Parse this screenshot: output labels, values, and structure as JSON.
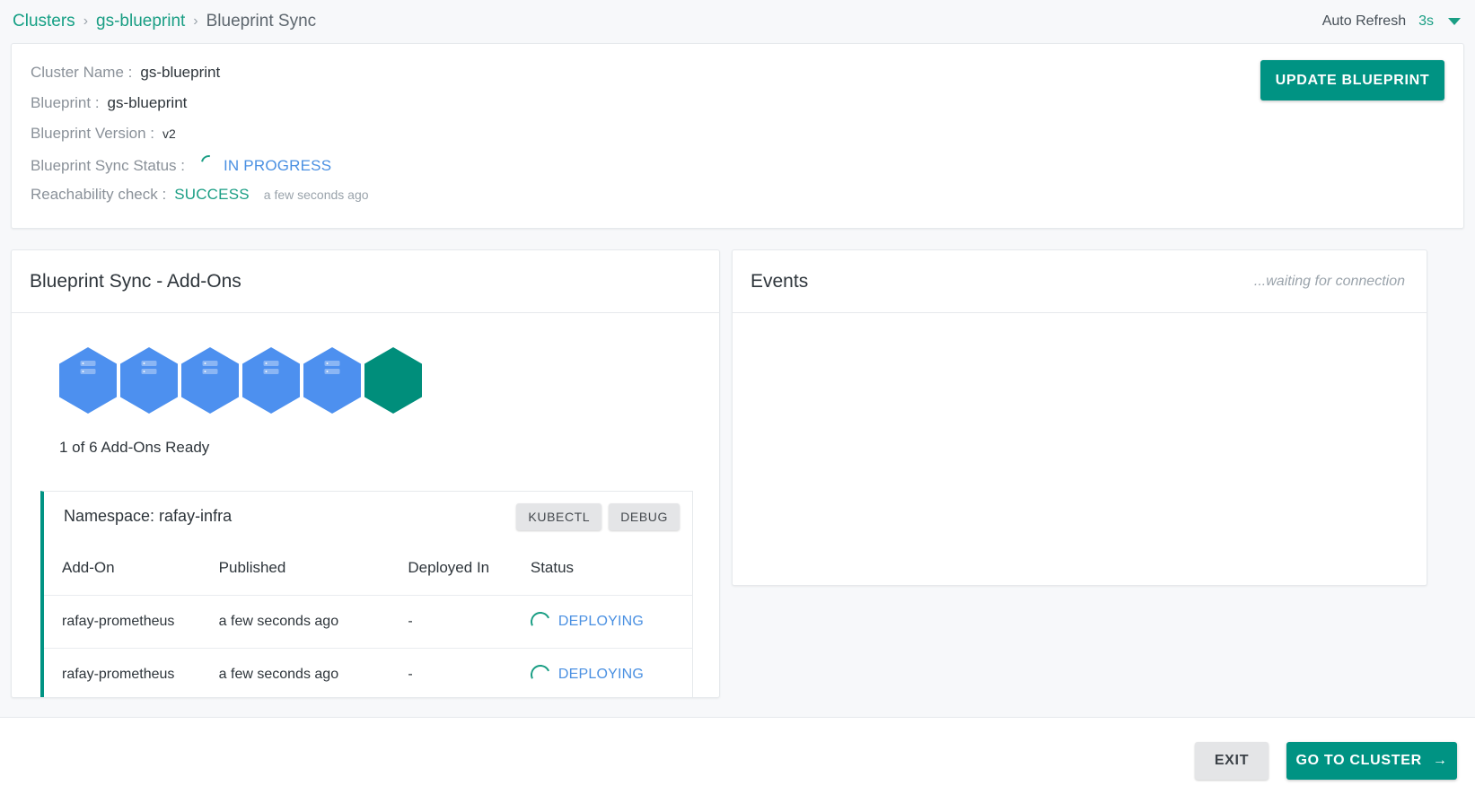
{
  "breadcrumb": {
    "items": [
      {
        "label": "Clusters",
        "type": "link"
      },
      {
        "label": "gs-blueprint",
        "type": "link"
      },
      {
        "label": "Blueprint Sync",
        "type": "current"
      }
    ],
    "separator": "›"
  },
  "auto_refresh": {
    "label": "Auto Refresh",
    "value": "3s",
    "chevron_icon": "chevron-down-icon"
  },
  "info": {
    "cluster_name_label": "Cluster Name :",
    "cluster_name_value": "gs-blueprint",
    "blueprint_label": "Blueprint :",
    "blueprint_value": "gs-blueprint",
    "blueprint_version_label": "Blueprint Version :",
    "blueprint_version_value": "v2",
    "sync_status_label": "Blueprint Sync Status :",
    "sync_status_value": "IN PROGRESS",
    "reachability_label": "Reachability check :",
    "reachability_value": "SUCCESS",
    "reachability_time": "a few seconds ago",
    "update_button": "UPDATE BLUEPRINT"
  },
  "addons_panel": {
    "title": "Blueprint Sync - Add-Ons",
    "ready_text": "1 of 6 Add-Ons Ready",
    "hexagons": [
      {
        "state": "pending",
        "color": "#4d90ef"
      },
      {
        "state": "pending",
        "color": "#4d90ef"
      },
      {
        "state": "pending",
        "color": "#4d90ef"
      },
      {
        "state": "pending",
        "color": "#4d90ef"
      },
      {
        "state": "pending",
        "color": "#4d90ef"
      },
      {
        "state": "ready",
        "color": "#008e7b"
      }
    ],
    "namespace": {
      "title": "Namespace: rafay-infra",
      "kubectl_button": "KUBECTL",
      "debug_button": "DEBUG"
    },
    "table": {
      "columns": [
        "Add-On",
        "Published",
        "Deployed In",
        "Status"
      ],
      "rows": [
        {
          "addon": "rafay-prometheus",
          "published": "a few seconds ago",
          "deployed_in": "-",
          "status": "DEPLOYING"
        },
        {
          "addon": "rafay-prometheus",
          "published": "a few seconds ago",
          "deployed_in": "-",
          "status": "DEPLOYING"
        }
      ]
    }
  },
  "events_panel": {
    "title": "Events",
    "status": "...waiting for connection"
  },
  "footer": {
    "exit_button": "EXIT",
    "goto_button": "GO TO CLUSTER",
    "arrow_icon": "arrow-right-icon",
    "arrow_glyph": "→"
  },
  "colors": {
    "accent_teal": "#009383",
    "link_teal": "#1a9e84",
    "status_blue": "#4a90e2",
    "hex_pending": "#4d90ef",
    "hex_ready": "#008e7b"
  }
}
